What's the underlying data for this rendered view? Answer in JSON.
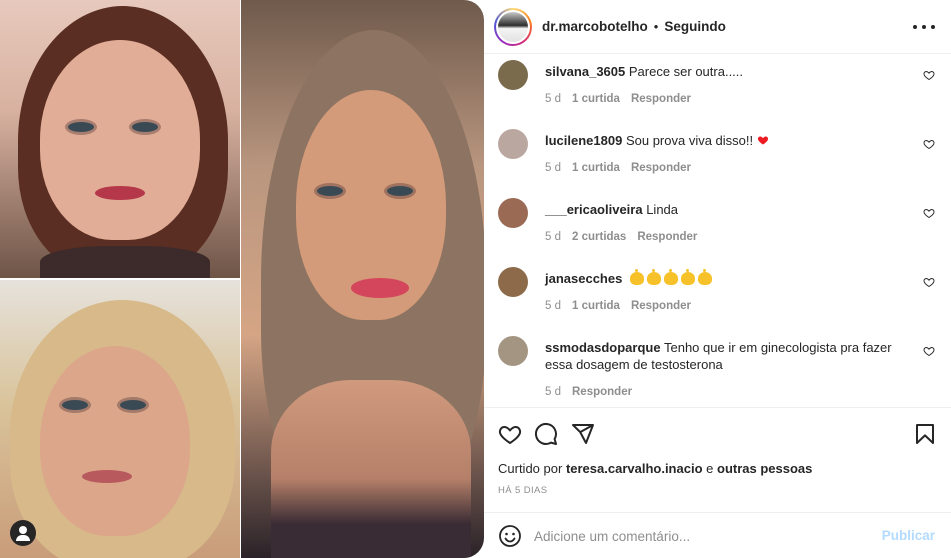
{
  "post": {
    "username": "dr.marcobotelho",
    "separator": "•",
    "follow_status": "Seguindo"
  },
  "comments": [
    {
      "username": "silvana_3605",
      "text": "Parece ser outra.....",
      "time": "5 d",
      "likes": "1 curtida",
      "reply": "Responder",
      "avatar_color": "#7a6b4c"
    },
    {
      "username": "lucilene1809",
      "text": "Sou prova viva disso!!",
      "emoji": "red-heart",
      "time": "5 d",
      "likes": "1 curtida",
      "reply": "Responder",
      "avatar_color": "#b9a7a0"
    },
    {
      "username": "___ericaoliveira",
      "text": "Linda",
      "time": "5 d",
      "likes": "2 curtidas",
      "reply": "Responder",
      "avatar_color": "#9b6a55"
    },
    {
      "username": "janasecches",
      "text": "",
      "emoji": "clapping-hands x5",
      "time": "5 d",
      "likes": "1 curtida",
      "reply": "Responder",
      "avatar_color": "#8c6a4a"
    },
    {
      "username": "ssmodasdoparque",
      "text": "Tenho que ir em ginecologista pra fazer essa dosagem de testosterona",
      "time": "5 d",
      "likes": "",
      "reply": "Responder",
      "avatar_color": "#a49582"
    }
  ],
  "actions": {
    "liked_by_prefix": "Curtido por",
    "liked_by_user": "teresa.carvalho.inacio",
    "liked_by_conj": "e",
    "liked_by_suffix": "outras pessoas",
    "post_time": "HÁ 5 DIAS"
  },
  "add_comment": {
    "placeholder": "Adicione um comentário...",
    "publish_label": "Publicar"
  },
  "colors": {
    "text": "#262626",
    "muted": "#8e8e8e",
    "divider": "#efefef",
    "publish_disabled": "#b3dbff",
    "heart_red": "#ed1c24"
  }
}
